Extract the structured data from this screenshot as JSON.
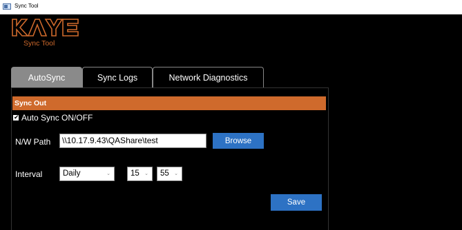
{
  "window": {
    "title": "Sync Tool"
  },
  "logo": {
    "brand": "KAYE",
    "subtitle": "Sync Tool"
  },
  "tabs": [
    {
      "label": "AutoSync",
      "active": true
    },
    {
      "label": "Sync Logs",
      "active": false
    },
    {
      "label": "Network Diagnostics",
      "active": false
    }
  ],
  "sync_out": {
    "header": "Sync Out",
    "auto_sync": {
      "label": "Auto Sync ON/OFF",
      "checked": true
    },
    "path": {
      "label": "N/W Path",
      "value": "\\\\10.17.9.43\\QAShare\\test",
      "browse_label": "Browse"
    },
    "interval": {
      "label": "Interval",
      "frequency": "Daily",
      "hour": "15",
      "minute": "55"
    },
    "save_label": "Save"
  },
  "colors": {
    "accent": "#cf6a2c",
    "button": "#2d72c4",
    "active_tab": "#8a8a8a"
  },
  "icons": {
    "app": "window-app-icon",
    "dropdown": "chevron-down-icon",
    "check": "check-icon"
  }
}
